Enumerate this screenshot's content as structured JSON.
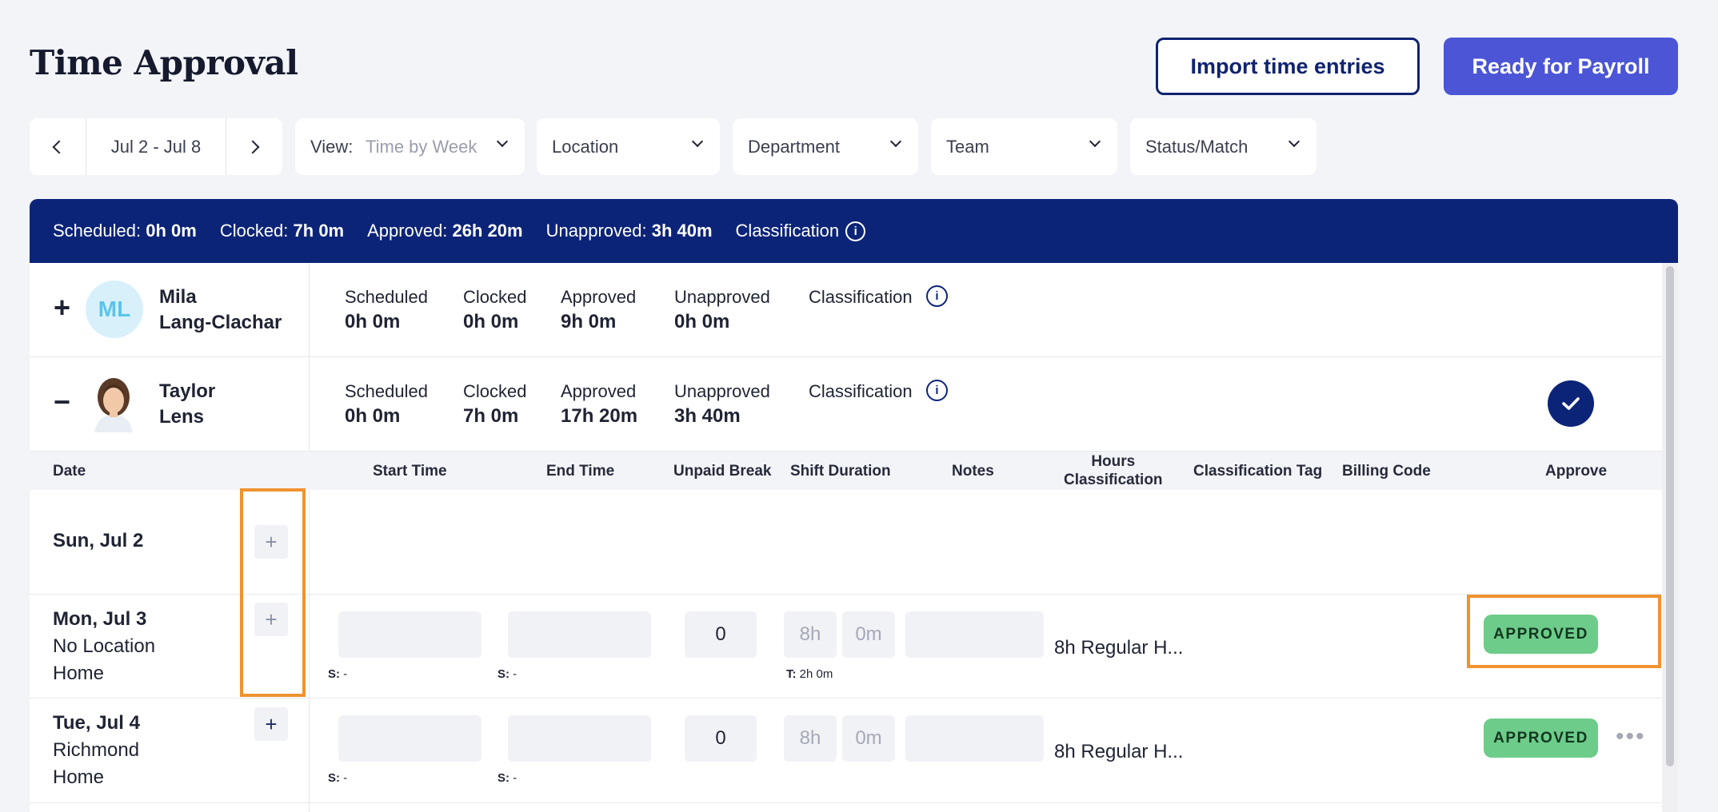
{
  "header": {
    "title": "Time Approval",
    "import_label": "Import time entries",
    "payroll_label": "Ready for Payroll"
  },
  "filters": {
    "date_range": "Jul 2 - Jul 8",
    "view_label": "View:",
    "view_value": "Time by Week",
    "location": "Location",
    "department": "Department",
    "team": "Team",
    "status": "Status/Match"
  },
  "summary": {
    "scheduled_label": "Scheduled:",
    "scheduled": "0h 0m",
    "clocked_label": "Clocked:",
    "clocked": "7h 0m",
    "approved_label": "Approved:",
    "approved": "26h 20m",
    "unapproved_label": "Unapproved:",
    "unapproved": "3h 40m",
    "classification_label": "Classification"
  },
  "employees": [
    {
      "toggle": "+",
      "initials": "ML",
      "first": "Mila",
      "last": "Lang-Clachar",
      "stats": {
        "scheduled_label": "Scheduled",
        "scheduled": "0h 0m",
        "clocked_label": "Clocked",
        "clocked": "0h 0m",
        "approved_label": "Approved",
        "approved": "9h 0m",
        "unapproved_label": "Unapproved",
        "unapproved": "0h 0m",
        "classification_label": "Classification"
      }
    },
    {
      "toggle": "−",
      "first": "Taylor",
      "last": "Lens",
      "stats": {
        "scheduled_label": "Scheduled",
        "scheduled": "0h 0m",
        "clocked_label": "Clocked",
        "clocked": "7h 0m",
        "approved_label": "Approved",
        "approved": "17h 20m",
        "unapproved_label": "Unapproved",
        "unapproved": "3h 40m",
        "classification_label": "Classification"
      }
    }
  ],
  "columns": {
    "date": "Date",
    "start": "Start Time",
    "end": "End Time",
    "break": "Unpaid Break",
    "duration": "Shift Duration",
    "notes": "Notes",
    "hours_class_1": "Hours",
    "hours_class_2": "Classification",
    "class_tag": "Classification Tag",
    "billing": "Billing Code",
    "approve": "Approve"
  },
  "days": [
    {
      "date": "Sun, Jul 2"
    },
    {
      "date": "Mon, Jul 3",
      "location": "No Location",
      "position": "Home",
      "break": "0",
      "dur_h": "8h",
      "dur_m": "0m",
      "s_label": "S:",
      "s_start": "-",
      "s_end": "-",
      "t_label": "T:",
      "t_value": "2h 0m",
      "hours_class": "8h Regular H...",
      "status": "APPROVED"
    },
    {
      "date": "Tue, Jul 4",
      "location": "Richmond",
      "position": "Home",
      "break": "0",
      "dur_h": "8h",
      "dur_m": "0m",
      "s_label": "S:",
      "s_start": "-",
      "s_end": "-",
      "hours_class": "8h Regular H...",
      "status": "APPROVED",
      "more": "•••"
    }
  ],
  "icons": {
    "add": "+",
    "info": "i"
  },
  "colors": {
    "navy": "#0c2478",
    "primary": "#4b55d6",
    "approved_badge": "#6dcc8a",
    "highlight": "#f0922f"
  }
}
